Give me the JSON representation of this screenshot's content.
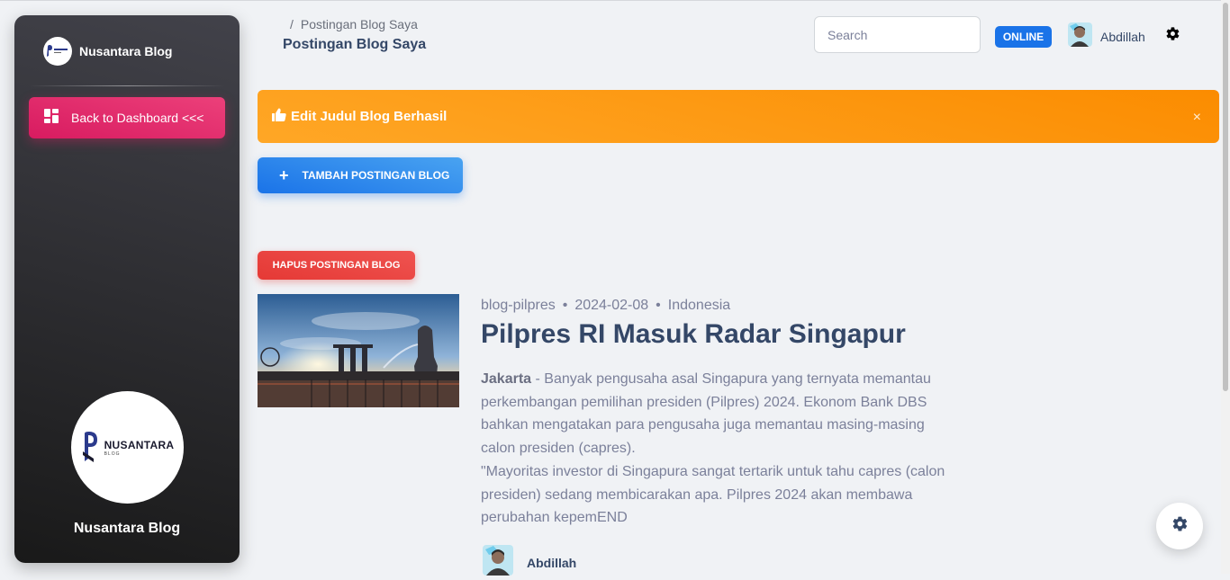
{
  "sidebar": {
    "brand_name": "Nusantara Blog",
    "back_button_label": "Back to Dashboard <<<",
    "logo_text_main": "NUSANTARA",
    "logo_text_sub": "BLOG",
    "footer_name": "Nusantara Blog"
  },
  "header": {
    "breadcrumb_separator": "/",
    "breadcrumb_current": "Postingan Blog Saya",
    "page_title": "Postingan Blog Saya",
    "search_placeholder": "Search",
    "status_badge": "ONLINE",
    "user_name": "Abdillah"
  },
  "alert": {
    "message": "Edit Judul Blog Berhasil",
    "close_symbol": "×"
  },
  "actions": {
    "add_label": "TAMBAH POSTINGAN BLOG",
    "delete_label": "HAPUS POSTINGAN BLOG"
  },
  "post": {
    "slug": "blog-pilpres",
    "date": "2024-02-08",
    "category": "Indonesia",
    "meta_separator": "•",
    "title": "Pilpres RI Masuk Radar Singapur",
    "excerpt_city": "Jakarta",
    "excerpt_p1": " - Banyak pengusaha asal Singapura yang ternyata memantau perkembangan pemilihan presiden (Pilpres) 2024. Ekonom Bank DBS bahkan mengatakan para pengusaha juga memantau masing-masing calon presiden (capres).",
    "excerpt_p2": "\"Mayoritas investor di Singapura sangat tertarik untuk tahu capres (calon presiden) sedang membicarakan apa. Pilpres 2024 akan membawa perubahan kepemEND",
    "author": "Abdillah"
  },
  "colors": {
    "primary": "#1A73E8",
    "pink": "#E91E63",
    "warning": "#FB8C00",
    "danger": "#F44335",
    "dark": "#344767"
  }
}
